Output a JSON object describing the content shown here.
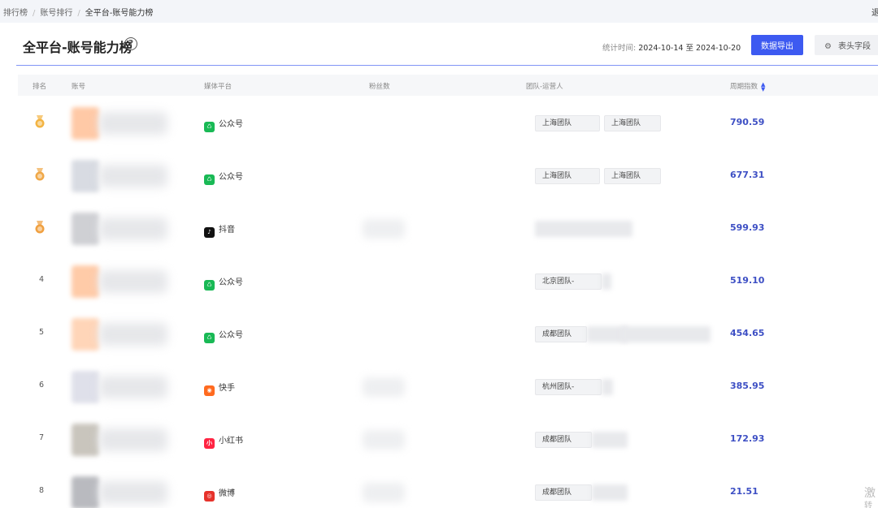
{
  "breadcrumb": [
    "排行榜",
    "账号排行",
    "全平台-账号能力榜"
  ],
  "top_right_text": "退",
  "page_title": "全平台-账号能力榜",
  "help_icon": "question-circle-icon",
  "stat": {
    "label": "统计时间:",
    "value": "2024-10-14 至 2024-10-20"
  },
  "buttons": {
    "export": "数据导出",
    "fields": "表头字段"
  },
  "table": {
    "columns": [
      "排名",
      "账号",
      "媒体平台",
      "粉丝数",
      "团队-运营人",
      "周期指数"
    ],
    "rows": [
      {
        "rank": "1",
        "medal": "gold",
        "platform": "公众号",
        "platform_icon": "wechat-icon",
        "tags": [
          "上海团队",
          "上海团队"
        ],
        "score": "790.59"
      },
      {
        "rank": "2",
        "medal": "silver",
        "platform": "公众号",
        "platform_icon": "wechat-icon",
        "tags": [
          "上海团队",
          "上海团队"
        ],
        "score": "677.31"
      },
      {
        "rank": "3",
        "medal": "bronze",
        "platform": "抖音",
        "platform_icon": "douyin-icon",
        "tags": [],
        "score": "599.93"
      },
      {
        "rank": "4",
        "platform": "公众号",
        "platform_icon": "wechat-icon",
        "tags": [
          "北京团队-"
        ],
        "score": "519.10"
      },
      {
        "rank": "5",
        "platform": "公众号",
        "platform_icon": "wechat-icon",
        "tags": [
          "成都团队"
        ],
        "score": "454.65"
      },
      {
        "rank": "6",
        "platform": "快手",
        "platform_icon": "kuaishou-icon",
        "tags": [
          "杭州团队-"
        ],
        "score": "385.95"
      },
      {
        "rank": "7",
        "platform": "小红书",
        "platform_icon": "xiaohongshu-icon",
        "tags": [
          "成都团队"
        ],
        "score": "172.93"
      },
      {
        "rank": "8",
        "platform": "微博",
        "platform_icon": "weibo-icon",
        "tags": [
          "成都团队"
        ],
        "score": "21.51"
      }
    ]
  },
  "watermark": {
    "line1": "激",
    "line2": "转"
  },
  "colors": {
    "accent": "#3d5af1",
    "score": "#3d4fc4",
    "wechat": "#19b955",
    "douyin": "#111111",
    "kuaishou": "#ff6a1f",
    "xiaohongshu": "#ff2442",
    "weibo": "#e6322b"
  }
}
